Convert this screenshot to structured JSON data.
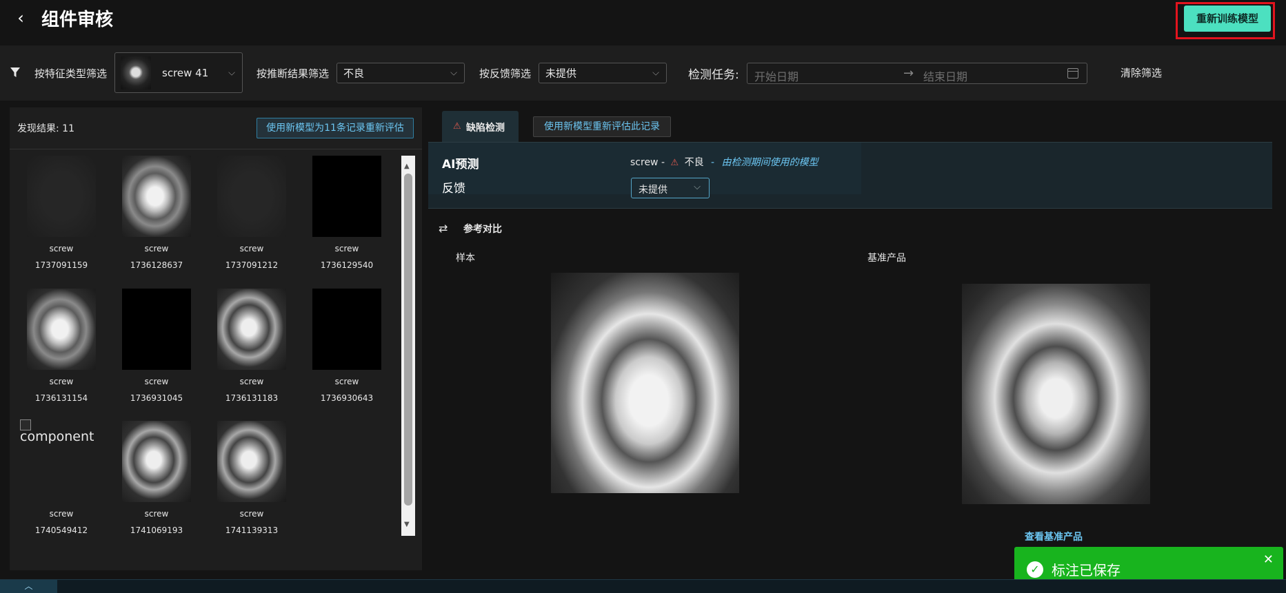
{
  "header": {
    "title": "组件审核",
    "retrain_button": "重新训练模型"
  },
  "filters": {
    "feature_type_label": "按特征类型筛选",
    "feature_type_value": "screw 41",
    "inference_label": "按推断结果筛选",
    "inference_value": "不良",
    "feedback_label": "按反馈筛选",
    "feedback_value": "未提供",
    "task_label": "检测任务:",
    "start_date_placeholder": "开始日期",
    "end_date_placeholder": "结束日期",
    "clear": "清除筛选"
  },
  "results": {
    "count_label": "发现结果: 11",
    "reevaluate_all": "使用新模型为11条记录重新评估",
    "items": [
      {
        "cls": "screw",
        "id": "1737091159",
        "img": "noise"
      },
      {
        "cls": "screw",
        "id": "1736128637",
        "img": "part"
      },
      {
        "cls": "screw",
        "id": "1737091212",
        "img": "noise"
      },
      {
        "cls": "screw",
        "id": "1736129540",
        "img": "dark"
      },
      {
        "cls": "screw",
        "id": "1736131154",
        "img": "part"
      },
      {
        "cls": "screw",
        "id": "1736931045",
        "img": "dark"
      },
      {
        "cls": "screw",
        "id": "1736131183",
        "img": "part2"
      },
      {
        "cls": "screw",
        "id": "1736930643",
        "img": "dark"
      },
      {
        "cls": "screw",
        "id": "1740549412",
        "img": "broken",
        "alt": "component"
      },
      {
        "cls": "screw",
        "id": "1741069193",
        "img": "part2"
      },
      {
        "cls": "screw",
        "id": "1741139313",
        "img": "part2"
      }
    ]
  },
  "detail": {
    "tab_defect": "缺陷检测",
    "reevaluate_one": "使用新模型重新评估此记录",
    "ai_prediction_label": "AI预测",
    "ai_prediction_class": "screw -",
    "ai_prediction_result": "不良",
    "ai_prediction_sep": "-",
    "ai_prediction_model": "由检测期间使用的模型",
    "feedback_label": "反馈",
    "feedback_value": "未提供",
    "reference_compare": "参考对比",
    "sample_label": "样本",
    "base_label": "基准产品",
    "view_base": "查看基准产品"
  },
  "toast": {
    "message": "标注已保存"
  },
  "colors": {
    "accent": "#4ce0c0",
    "link": "#6cc6f2",
    "highlight_border": "#e3141e",
    "toast_bg": "#18b41e",
    "warning": "#e05a4f"
  },
  "icons": [
    "back-icon",
    "filter-funnel-icon",
    "chevron-down-icon",
    "calendar-icon",
    "warning-icon",
    "swap-icon",
    "check-circle-icon",
    "close-icon",
    "chevron-up-icon"
  ]
}
